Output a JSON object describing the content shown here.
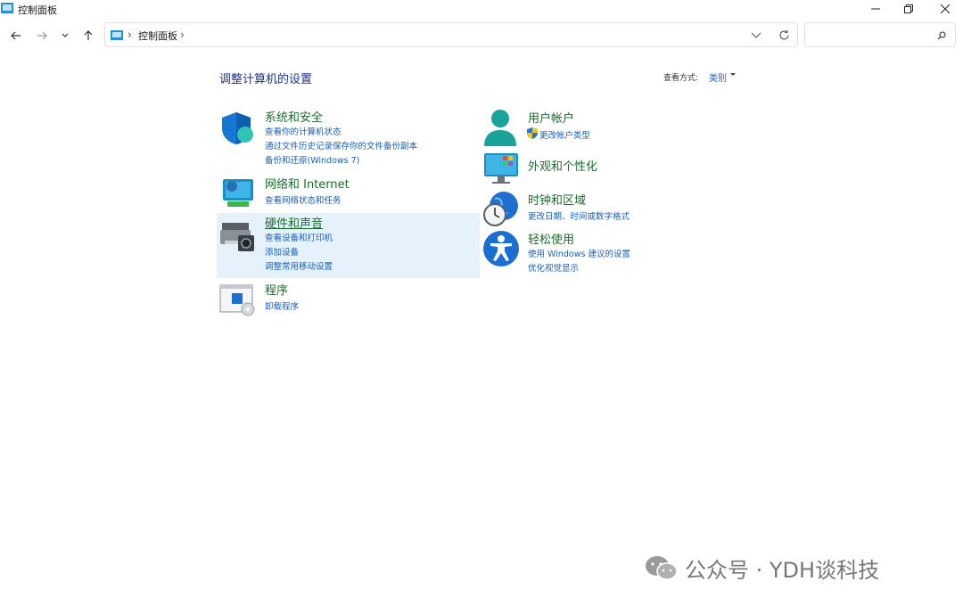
{
  "window": {
    "title": "控制面板"
  },
  "address": {
    "path": "控制面板",
    "search_placeholder": ""
  },
  "content": {
    "heading": "调整计算机的设置",
    "view_by_label": "查看方式:",
    "view_by_value": "类别"
  },
  "categories": [
    {
      "title": "系统和安全",
      "links": [
        "查看你的计算机状态",
        "通过文件历史记录保存你的文件备份副本",
        "备份和还原(Windows 7)"
      ]
    },
    {
      "title": "网络和 Internet",
      "links": [
        "查看网络状态和任务"
      ]
    },
    {
      "title": "硬件和声音",
      "links": [
        "查看设备和打印机",
        "添加设备",
        "调整常用移动设置"
      ]
    },
    {
      "title": "程序",
      "links": [
        "卸载程序"
      ]
    },
    {
      "title": "用户帐户",
      "links": [
        "更改帐户类型"
      ]
    },
    {
      "title": "外观和个性化",
      "links": []
    },
    {
      "title": "时钟和区域",
      "links": [
        "更改日期、时间或数字格式"
      ]
    },
    {
      "title": "轻松使用",
      "links": [
        "使用 Windows 建议的设置",
        "优化视觉显示"
      ]
    }
  ],
  "watermark": {
    "text": "公众号 · YDH谈科技"
  }
}
